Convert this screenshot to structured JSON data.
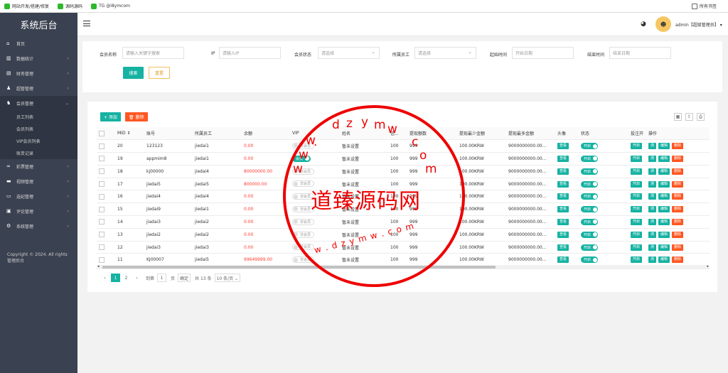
{
  "bookmarks": [
    {
      "label": "网站开发/搭建/修复",
      "color": "#2eb82e"
    },
    {
      "label": "源码源码",
      "color": "#2eb82e"
    },
    {
      "label": "TG @i8ymcom",
      "color": "#2eb82e"
    }
  ],
  "bookmarks_right": "所有书签",
  "sidebar": {
    "title": "系统后台",
    "items": [
      {
        "label": "首页",
        "icon": "home-icon",
        "glyph": "⌂",
        "arrow": ""
      },
      {
        "label": "数据统计",
        "icon": "chart-icon",
        "glyph": "▥",
        "arrow": "›"
      },
      {
        "label": "财务管理",
        "icon": "wallet-icon",
        "glyph": "▤",
        "arrow": "›"
      },
      {
        "label": "超管管理",
        "icon": "user-icon",
        "glyph": "♟",
        "arrow": "›"
      },
      {
        "label": "会员管理",
        "icon": "users-icon",
        "glyph": "♞",
        "arrow": "⌄"
      }
    ],
    "submenu": [
      "员工列表",
      "会员列表",
      "VIP会员列表",
      "账变记录"
    ],
    "items_after": [
      {
        "label": "彩票管理",
        "icon": "ticket-icon",
        "glyph": "∞",
        "arrow": "›"
      },
      {
        "label": "视频管理",
        "icon": "video-icon",
        "glyph": "▬",
        "arrow": "›"
      },
      {
        "label": "选妃管理",
        "icon": "heart-icon",
        "glyph": "▭",
        "arrow": "›"
      },
      {
        "label": "评论管理",
        "icon": "comment-icon",
        "glyph": "▣",
        "arrow": "›"
      },
      {
        "label": "系统管理",
        "icon": "gear-icon",
        "glyph": "⚙",
        "arrow": "›"
      }
    ],
    "copyright": "Copyright © 2024. All rights 管理后台"
  },
  "header": {
    "user": "admin【超级管理员】",
    "avatar_glyph": "☻"
  },
  "filters": {
    "member_label": "会员名称",
    "member_placeholder": "请输入关键字搜索",
    "ip_label": "IP",
    "ip_placeholder": "请输入IP",
    "status_label": "会员状态",
    "status_value": "请选择",
    "staff_label": "所属员工",
    "staff_value": "请选择",
    "start_label": "起始时间",
    "start_placeholder": "开始日期",
    "end_label": "结束时间",
    "end_placeholder": "结束日期",
    "search_btn": "搜索",
    "reset_btn": "重置"
  },
  "toolbar": {
    "add": "+ 添加",
    "delete": "🗑 删除"
  },
  "table": {
    "headers": [
      "MID ⇕",
      "账号",
      "所属员工",
      "余额",
      "VIP",
      "姓名",
      "信...",
      "提现额数",
      "提现最少金额",
      "提现最多金额",
      "头像",
      "状态",
      "投注开",
      "操作"
    ],
    "rows": [
      {
        "mid": "20",
        "account": "123123",
        "staff": "jiedai1",
        "balance": "0.00",
        "vip": "非会员",
        "vip_on": false,
        "name": "暂未设置",
        "credit": "100",
        "count": "999",
        "min": "100.00KRW",
        "max": "9000000000.00..."
      },
      {
        "mid": "19",
        "account": "appmim8",
        "staff": "jiedai1",
        "balance": "0.00",
        "vip": "会员",
        "vip_on": true,
        "name": "暂未设置",
        "credit": "100",
        "count": "999",
        "min": "100.00KRW",
        "max": "9000000000.00..."
      },
      {
        "mid": "18",
        "account": "kj00000",
        "staff": "jiedai4",
        "balance": "80000000.00",
        "vip": "非会员",
        "vip_on": false,
        "name": "暂未设置",
        "credit": "100",
        "count": "999",
        "min": "100.00KRW",
        "max": "9000000000.00..."
      },
      {
        "mid": "17",
        "account": "jiedai5",
        "staff": "jiedai5",
        "balance": "800000.00",
        "vip": "非会员",
        "vip_on": false,
        "name": "暂未设置",
        "credit": "100",
        "count": "999",
        "min": "100.00KRW",
        "max": "9000000000.00..."
      },
      {
        "mid": "16",
        "account": "jiedai4",
        "staff": "jiedai4",
        "balance": "0.00",
        "vip": "非会员",
        "vip_on": false,
        "name": "暂未设置",
        "credit": "100",
        "count": "999",
        "min": "100.00KRW",
        "max": "9000000000.00..."
      },
      {
        "mid": "15",
        "account": "jiedai9",
        "staff": "jiedai1",
        "balance": "0.00",
        "vip": "非会员",
        "vip_on": false,
        "name": "暂未设置",
        "credit": "100",
        "count": "999",
        "min": "100.00KRW",
        "max": "9000000000.00..."
      },
      {
        "mid": "14",
        "account": "jiadai3",
        "staff": "jiedai2",
        "balance": "0.00",
        "vip": "非会员",
        "vip_on": false,
        "name": "暂未设置",
        "credit": "100",
        "count": "999",
        "min": "100.00KRW",
        "max": "9000000000.00..."
      },
      {
        "mid": "13",
        "account": "jiedai2",
        "staff": "jiedai2",
        "balance": "0.00",
        "vip": "非会员",
        "vip_on": false,
        "name": "暂未设置",
        "credit": "100",
        "count": "999",
        "min": "100.00KRW",
        "max": "9000000000.00..."
      },
      {
        "mid": "12",
        "account": "jiedai3",
        "staff": "jiedai3",
        "balance": "0.00",
        "vip": "非会员",
        "vip_on": false,
        "name": "暂未设置",
        "credit": "100",
        "count": "999",
        "min": "100.00KRW",
        "max": "9000000000.00..."
      },
      {
        "mid": "11",
        "account": "KJ00007",
        "staff": "jiedai5",
        "balance": "99649999.00",
        "vip": "非会员",
        "vip_on": false,
        "name": "暂未设置",
        "credit": "100",
        "count": "999",
        "min": "100.00KRW",
        "max": "9000000000.00..."
      }
    ],
    "view_btn": "查看",
    "status_on": "开启",
    "bet_on": "开启",
    "actions": [
      "测",
      "编辑",
      "删除"
    ]
  },
  "pagination": {
    "pages": [
      "1",
      "2"
    ],
    "goto_label": "到第",
    "goto_value": "1",
    "page_suffix": "页",
    "confirm": "确定",
    "total": "共 13 条",
    "per_page": "10 条/页 ⌄"
  },
  "watermark": {
    "center": "道臻源码网",
    "top_letters": [
      "d",
      "z",
      "y",
      "m",
      "w",
      "."
    ],
    "left_letters": [
      "w",
      "w",
      "w"
    ],
    "right_letters": [
      "c",
      "o",
      "m"
    ],
    "bottom_text": "w . d z y m w . c o m"
  }
}
